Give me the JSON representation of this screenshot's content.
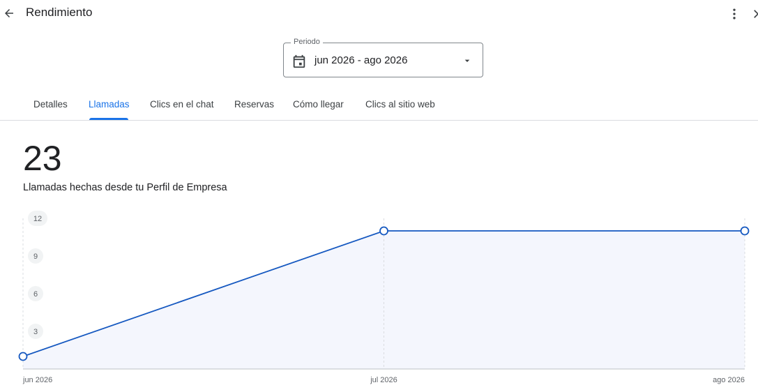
{
  "header": {
    "title": "Rendimiento"
  },
  "period": {
    "label": "Periodo",
    "value": "jun 2026 - ago 2026"
  },
  "tabs": [
    {
      "label": "Detalles",
      "active": false
    },
    {
      "label": "Llamadas",
      "active": true
    },
    {
      "label": "Clics en el chat",
      "active": false
    },
    {
      "label": "Reservas",
      "active": false
    },
    {
      "label": "Cómo llegar",
      "active": false
    },
    {
      "label": "Clics al sitio web",
      "active": false
    }
  ],
  "metric": {
    "value": "23",
    "caption": "Llamadas hechas desde tu Perfil de Empresa"
  },
  "icons": {
    "back": "arrow-back-icon",
    "more": "more-vert-icon",
    "close": "close-icon",
    "calendar": "calendar-icon",
    "caret": "arrow-drop-down-icon"
  },
  "colors": {
    "accent": "#1a73e8",
    "line": "#1558c0",
    "area": "#f4f6fd"
  },
  "chart_data": {
    "type": "area",
    "x": [
      "jun 2026",
      "jul 2026",
      "ago 2026"
    ],
    "series": [
      {
        "values": [
          1,
          11,
          11
        ]
      }
    ],
    "yticks": [
      3,
      6,
      9,
      12
    ],
    "ylim": [
      0,
      12
    ],
    "title": "",
    "xlabel": "",
    "ylabel": "",
    "grid": true
  }
}
